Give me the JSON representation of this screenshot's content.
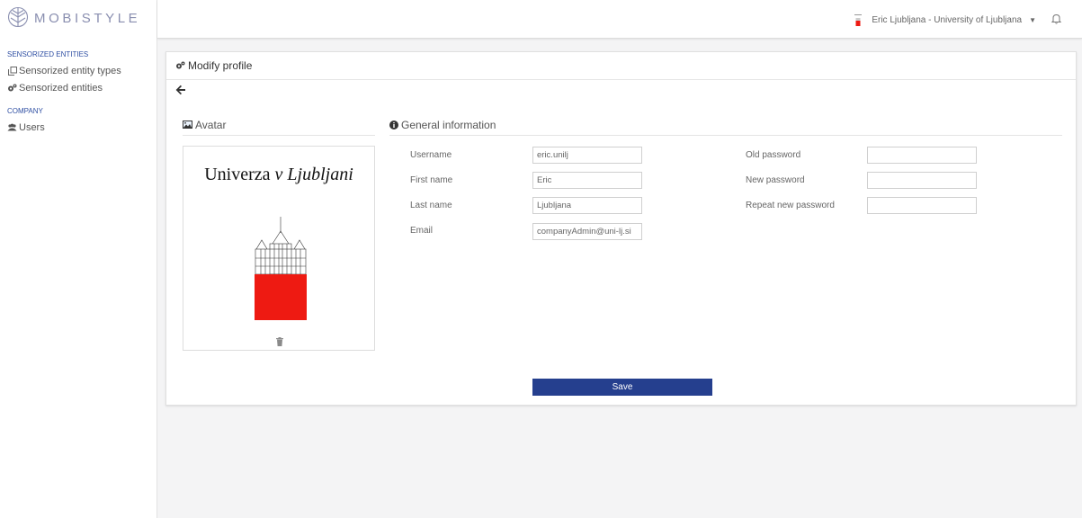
{
  "brand": {
    "name": "MOBISTYLE"
  },
  "sidebar": {
    "sections": [
      {
        "heading": "SENSORIZED ENTITIES",
        "items": [
          {
            "label": "Sensorized entity types",
            "icon": "clone-icon"
          },
          {
            "label": "Sensorized entities",
            "icon": "cogs-icon"
          }
        ]
      },
      {
        "heading": "COMPANY",
        "items": [
          {
            "label": "Users",
            "icon": "users-icon"
          }
        ]
      }
    ]
  },
  "topbar": {
    "user_label": "Eric Ljubljana - University of Ljubljana",
    "icons": [
      "org-icon",
      "caret-down-icon",
      "bell-icon"
    ]
  },
  "panel": {
    "title": "Modify profile",
    "avatar": {
      "title": "Avatar",
      "image_text": {
        "normal": "Univerza ",
        "italic": "v Ljubljani"
      }
    },
    "general": {
      "title": "General information",
      "fields": {
        "username": {
          "label": "Username",
          "value": "eric.unilj"
        },
        "first_name": {
          "label": "First name",
          "value": "Eric"
        },
        "last_name": {
          "label": "Last name",
          "value": "Ljubljana"
        },
        "email": {
          "label": "Email",
          "value": "companyAdmin@uni-lj.si"
        },
        "old_password": {
          "label": "Old password",
          "value": ""
        },
        "new_password": {
          "label": "New password",
          "value": ""
        },
        "repeat_password": {
          "label": "Repeat new password",
          "value": ""
        }
      }
    },
    "save_label": "Save"
  },
  "colors": {
    "primary": "#253f8e",
    "accent_red": "#ee1a12",
    "sidebar_heading": "#2f4fa3",
    "logo_text": "#8a8fb0"
  }
}
